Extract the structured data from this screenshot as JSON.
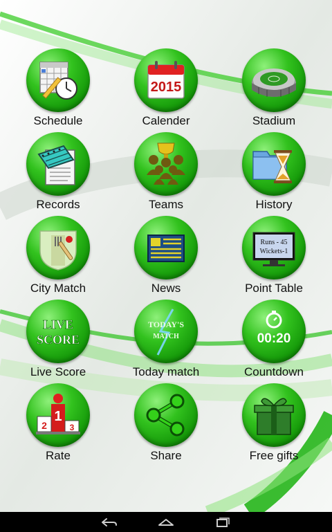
{
  "colors": {
    "tile_green": "#1fa80f",
    "swoosh_green": "#22c21a",
    "navbar": "#000000"
  },
  "icons": {
    "schedule": "calendar-clock-icon",
    "calender": "calendar-2015-icon",
    "stadium": "stadium-icon",
    "records": "notebook-icon",
    "teams": "team-trophy-icon",
    "history": "hourglass-folder-icon",
    "city_match": "cricket-pitch-icon",
    "news": "newspaper-icon",
    "point_table": "scoreboard-monitor-icon",
    "live_score": "live-score-icon",
    "today_match": "todays-match-icon",
    "countdown": "stopwatch-icon",
    "rate": "podium-icon",
    "share": "share-icon",
    "free_gifts": "gift-box-icon",
    "nav_back": "back-icon",
    "nav_home": "home-icon",
    "nav_recent": "recent-apps-icon"
  },
  "menu": {
    "schedule": "Schedule",
    "calender": "Calender",
    "calender_year": "2015",
    "stadium": "Stadium",
    "records": "Records",
    "teams": "Teams",
    "history": "History",
    "city_match": "City Match",
    "news": "News",
    "point_table": "Point Table",
    "point_table_line1": "Runs - 45",
    "point_table_line2": "Wickets-1",
    "live_score": "Live Score",
    "live_score_line1": "LIVE",
    "live_score_line2": "SCORE",
    "today_match": "Today match",
    "today_match_line1": "TODAY'S",
    "today_match_line2": "MATCH",
    "countdown": "Countdown",
    "countdown_time": "00:20",
    "rate": "Rate",
    "rate_place1": "1",
    "rate_place2": "2",
    "rate_place3": "3",
    "share": "Share",
    "free_gifts": "Free gifts"
  }
}
